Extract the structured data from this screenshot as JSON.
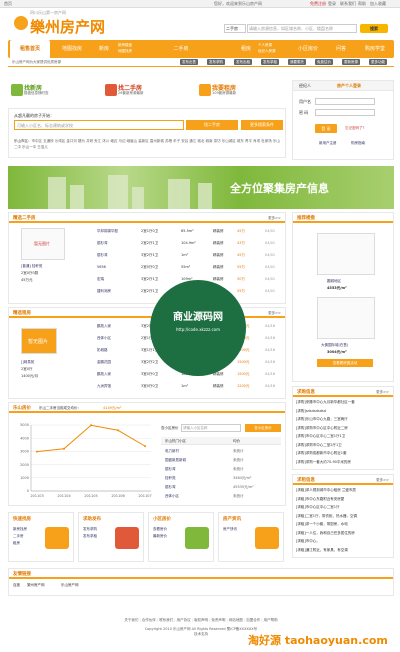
{
  "topbar": {
    "home": "首页",
    "welcome": "您好，欢迎来到乐山房产网",
    "register": "免费注册",
    "login": "登录",
    "contact": "联系我们",
    "help": "帮助",
    "fav": "加入收藏"
  },
  "logo": {
    "slogan": "四川乐山第一房产网",
    "name": "樂州房产网"
  },
  "top_search": {
    "select": "二手房",
    "placeholder": "请输入房源信息，如区域名称、小区、楼盘名称",
    "button": "搜索"
  },
  "nav": {
    "items": [
      "租售首页",
      "地图找房",
      "新房",
      "二手房",
      "租房",
      "小区房价",
      "问答",
      "购房学堂"
    ],
    "subs": [
      [
        "新房楼盘",
        "地图找房"
      ],
      [
        "个人房源",
        "经纪人房源"
      ],
      [
        "写字楼",
        "商铺"
      ]
    ]
  },
  "subnav": {
    "tip": "乐山房产网为大家提供优质房源",
    "tags": [
      "发布出售",
      "发布求购",
      "发布出租",
      "发布求租",
      "我要委托",
      "免费估价",
      "更新房源",
      "更多功能"
    ]
  },
  "quick": [
    {
      "title": "找新房",
      "sub": "楼盘信息随时查",
      "color": "#7fb83b"
    },
    {
      "title": "找二手房",
      "sub": "26套新房源最新",
      "color": "#e05a3a"
    },
    {
      "title": "我要租房",
      "sub": "109套房源最新",
      "color": "#f7a019"
    }
  ],
  "search_panel": {
    "hint": "从超凡靓的房子开始：",
    "placeholder": "可输入小区名、标志建筑或学校",
    "btn1": "找二手房",
    "btn2": "更多搜索条件",
    "areas_label": "乐山市区：",
    "areas": "市中区 五通桥 沙湾区 金口河 犍为 井研 夹江 沐川 峨边 马边 峨眉山 高新区 嘉州新城 苏稽 牟子 安谷 通江 城北 城南 茶坊 乐山城区 城东 青平 肖坝 杜家场 乐山二中 乐山一中 王浩儿"
  },
  "login": {
    "tab1": "经纪人",
    "tab2": "房产个人登录",
    "user_label": "用户名",
    "pass_label": "密 码",
    "button": "登 录",
    "forgot": "忘记密码了?",
    "register": "新用户注册",
    "guide": "购房指南"
  },
  "banner": {
    "text": "全方位聚集房产信息"
  },
  "sale": {
    "title": "精选二手房",
    "more": "更多>>",
    "featured": {
      "label": "暂无图片",
      "area": "[普通] 桂轩苑",
      "type": "2室0厅0厨",
      "price": "45万元"
    },
    "rows": [
      {
        "name": "华邦锦锦华庭",
        "type": "2室1厅0卫",
        "area": "65.5m²",
        "deco": "精装修",
        "price": "45万",
        "date": "04/01"
      },
      {
        "name": "银杉湾",
        "type": "2室2厅1卫",
        "area": "104.9m²",
        "deco": "精装修",
        "price": "43万",
        "date": "04/01"
      },
      {
        "name": "银杉湾",
        "type": "3室2厅1卫",
        "area": "1m²",
        "deco": "精装修",
        "price": "45万",
        "date": "04/01"
      },
      {
        "name": "5656",
        "type": "2室0厅0卫",
        "area": "55m²",
        "deco": "精装修",
        "price": "55万",
        "date": "04/01"
      },
      {
        "name": "宏瑞",
        "type": "3室2厅1卫",
        "area": "109m²",
        "deco": "精装修",
        "price": "30万",
        "date": "04/01"
      },
      {
        "name": "捷利润房",
        "type": "2室2厅1卫",
        "area": "1m²",
        "deco": "精装修",
        "price": "55万",
        "date": "04/01"
      }
    ]
  },
  "rent": {
    "title": "精选租房",
    "more": "更多>>",
    "featured": {
      "label": "暂无图片",
      "area": "[]网易苑",
      "type": "2室0厅",
      "price": "1400元/月"
    },
    "rows": [
      {
        "name": "鹏苑入家",
        "type": "3室2厅0卫",
        "area": "90m²",
        "deco": "精装修",
        "price": "1500元",
        "date": "04/16"
      },
      {
        "name": "西体小区",
        "type": "2室1厅1卫",
        "area": "100m²",
        "deco": "精装修",
        "price": "1200元",
        "date": "04/16"
      },
      {
        "name": "奶城路",
        "type": "3室1厅1卫",
        "area": "1m²",
        "deco": "精装修",
        "price": "1200元",
        "date": "04/16"
      },
      {
        "name": "金鹏花园",
        "type": "3室2厅2卫",
        "area": "150m²",
        "deco": "精装修",
        "price": "1500元",
        "date": "04/16"
      },
      {
        "name": "鹏苑入家",
        "type": "3室0厅0卫",
        "area": "180m²",
        "deco": "精装修",
        "price": "1500元",
        "date": "04/16"
      },
      {
        "name": "九洲宾馆",
        "type": "3室0厅0卫",
        "area": "1m²",
        "deco": "精装修",
        "price": "1200元",
        "date": "04/16"
      }
    ]
  },
  "price_trend": {
    "title": "乐山房价",
    "desc": "乐山二手房当前成交均价：",
    "value": "4149元/m²",
    "search_label": "查小区房价",
    "search_placeholder": "请输入小区名称",
    "search_button": "查小区房价",
    "table_headers": [
      "乐山热门小区",
      "均价"
    ],
    "table_rows": [
      {
        "name": "电力新村",
        "price": "未统计"
      },
      {
        "name": "国盛新居新城",
        "price": "未统计"
      },
      {
        "name": "银杉湾",
        "price": "未统计"
      },
      {
        "name": "桂轩苑",
        "price": "3464元/m²"
      },
      {
        "name": "银杉湾",
        "price": "45535元/m²"
      },
      {
        "name": "西体小区",
        "price": "未统计"
      }
    ]
  },
  "chart_data": {
    "type": "line",
    "x": [
      "201103",
      "201104",
      "201105",
      "201106",
      "201107"
    ],
    "series": [
      {
        "values": [
          2980,
          3200,
          4980,
          4600,
          3400
        ]
      }
    ],
    "yticks": [
      "5000",
      "4000",
      "3000",
      "2000",
      "1000",
      "0"
    ],
    "ylim": [
      0,
      5000
    ],
    "grid": true,
    "color": "#f08a00"
  },
  "recommend": {
    "title": "推荐楼盘",
    "items": [
      {
        "name": "圆城地区",
        "price": "4553元/m²"
      },
      {
        "name": "大佛国际城(在售)",
        "price": "3004元/m²"
      }
    ],
    "button": "查看看房团活动"
  },
  "ask_sale": {
    "title": "求购信息",
    "more": "更多>>",
    "items": [
      "[求购]来撒市中心九月新华都社区一套",
      "[求购]sdsdsdsdsd",
      "[求购]乐山市中心九路，三室两厅",
      "[求购]求购市中心区中心附近二房",
      "[求购]市中心区中心二室1厅1卫",
      "[求购]求购市中心二室2厅1卫",
      "[求购]求购成都新市中心附近1套",
      "[求购]求购一套大约70-90平米的房"
    ]
  },
  "ask_rent": {
    "title": "求租信息",
    "more": "更多>>",
    "items": [
      "[求租]求人想到城市中心租房 兰盛市居",
      "[求租]市中心东路附近有安房屋",
      "[求租]市中心区中心二室1厅",
      "[求租]二室1厅，带衣柜，热水器，空调",
      "[求租]求一个小套，带厨房，水电",
      "[求租]一人住，我和自己任多居住的房",
      "[求租]市中心。",
      "[求租]通江附近，有家具，有空调"
    ]
  },
  "bottom_boxes": [
    {
      "title": "快速找房",
      "links": [
        "新房找房",
        "二手房",
        "租房"
      ]
    },
    {
      "title": "求助发布",
      "links": [
        "发布求购",
        "发布求租"
      ]
    },
    {
      "title": "小区房价",
      "links": [
        "查看房价",
        "最新房价"
      ]
    },
    {
      "title": "房产资讯",
      "links": [
        "房产快讯"
      ]
    }
  ],
  "links": {
    "title": "友情链接",
    "items": [
      "百度",
      "樂州房产网",
      "乐山房产网"
    ]
  },
  "footer": {
    "links": [
      "关于我们",
      "合作伙伴",
      "联系我们",
      "用户协议",
      "版权声明",
      "免责声明",
      "网站地图",
      "加盟合作",
      "用户帮助"
    ],
    "copyright": "Copyright 2010 乐山房产网 All Rights Reserved 蜀ICP备XXXXXX号",
    "tech": "技术支持"
  },
  "watermark": {
    "title": "商业源码网",
    "url": "http://code.xkzzz.com",
    "bottom": "淘好源 taohaoyuan.com"
  }
}
